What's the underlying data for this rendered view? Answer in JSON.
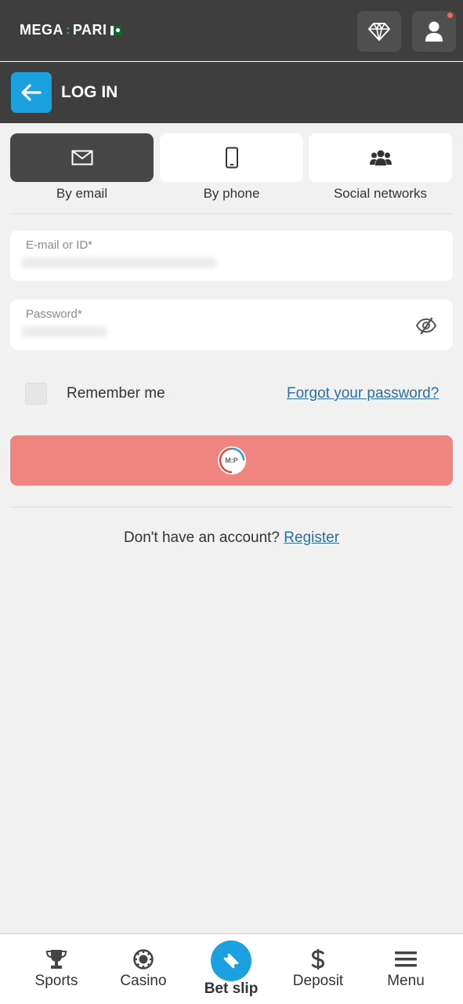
{
  "header": {
    "logo_part1": "MEGA",
    "logo_sep": ":",
    "logo_part2": "PARI",
    "gem_icon": "diamond-icon",
    "user_icon": "user-icon"
  },
  "subheader": {
    "title": "LOG IN",
    "back_icon": "arrow-left-icon"
  },
  "tabs": [
    {
      "label": "By email",
      "icon": "envelope-icon",
      "active": true
    },
    {
      "label": "By phone",
      "icon": "phone-icon",
      "active": false
    },
    {
      "label": "Social networks",
      "icon": "users-icon",
      "active": false
    }
  ],
  "form": {
    "email_label": "E-mail or ID*",
    "password_label": "Password*",
    "remember_label": "Remember me",
    "forgot_label": "Forgot your password?",
    "login_spinner_text": "M:P"
  },
  "signup": {
    "question": "Don't have an account? ",
    "link": "Register"
  },
  "bottom_nav": [
    {
      "label": "Sports",
      "icon": "trophy-icon"
    },
    {
      "label": "Casino",
      "icon": "casino-chip-icon"
    },
    {
      "label": "Bet slip",
      "icon": "ticket-icon"
    },
    {
      "label": "Deposit",
      "icon": "dollar-icon"
    },
    {
      "label": "Menu",
      "icon": "hamburger-icon"
    }
  ],
  "colors": {
    "header_bg": "#3e3e3e",
    "accent": "#1ba0e0",
    "login_button": "#f0847e",
    "link": "#2c6fa3"
  }
}
